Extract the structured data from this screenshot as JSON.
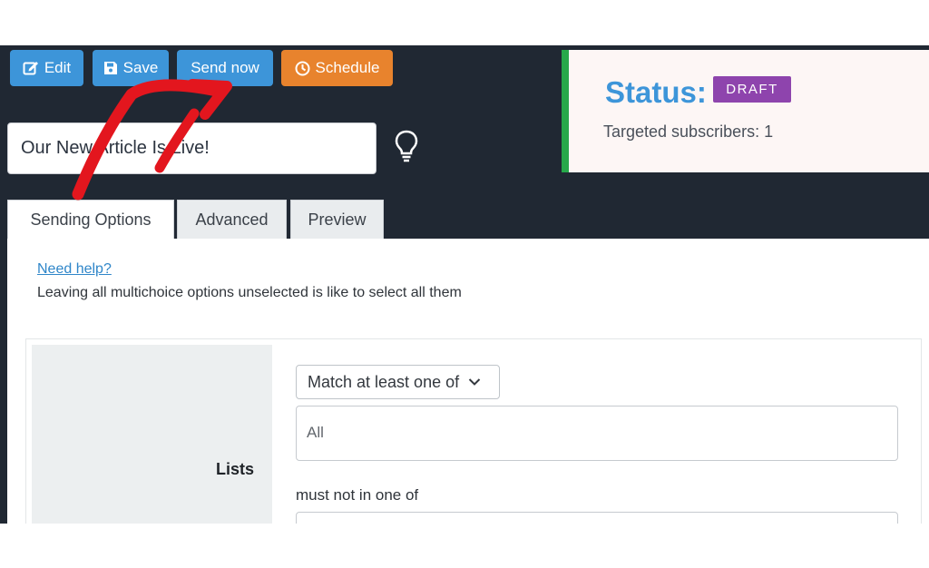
{
  "toolbar": {
    "edit_label": "Edit",
    "save_label": "Save",
    "send_label": "Send now",
    "schedule_label": "Schedule"
  },
  "campaign": {
    "title_value": "Our New Article Is Live!"
  },
  "status": {
    "label": "Status:",
    "badge": "DRAFT",
    "targeted": "Targeted subscribers: 1"
  },
  "tabs": [
    {
      "label": "Sending Options"
    },
    {
      "label": "Advanced"
    },
    {
      "label": "Preview"
    }
  ],
  "sending_options": {
    "help_link": "Need help?",
    "help_text": "Leaving all multichoice options unselected is like to select all them",
    "lists_label": "Lists",
    "match_select": "Match at least one of",
    "lists_value": "All",
    "exclude_label": "must not in one of"
  },
  "colors": {
    "dark_bg": "#202833",
    "blue": "#3d95d9",
    "orange": "#e8832d",
    "green": "#27a84a",
    "purple": "#8e44ad",
    "arrow_red": "#e3161e"
  },
  "icons": {
    "edit": "edit-icon",
    "save": "save-icon",
    "schedule": "clock-icon",
    "tip": "lightbulb-icon",
    "select": "chevron-down-icon"
  }
}
